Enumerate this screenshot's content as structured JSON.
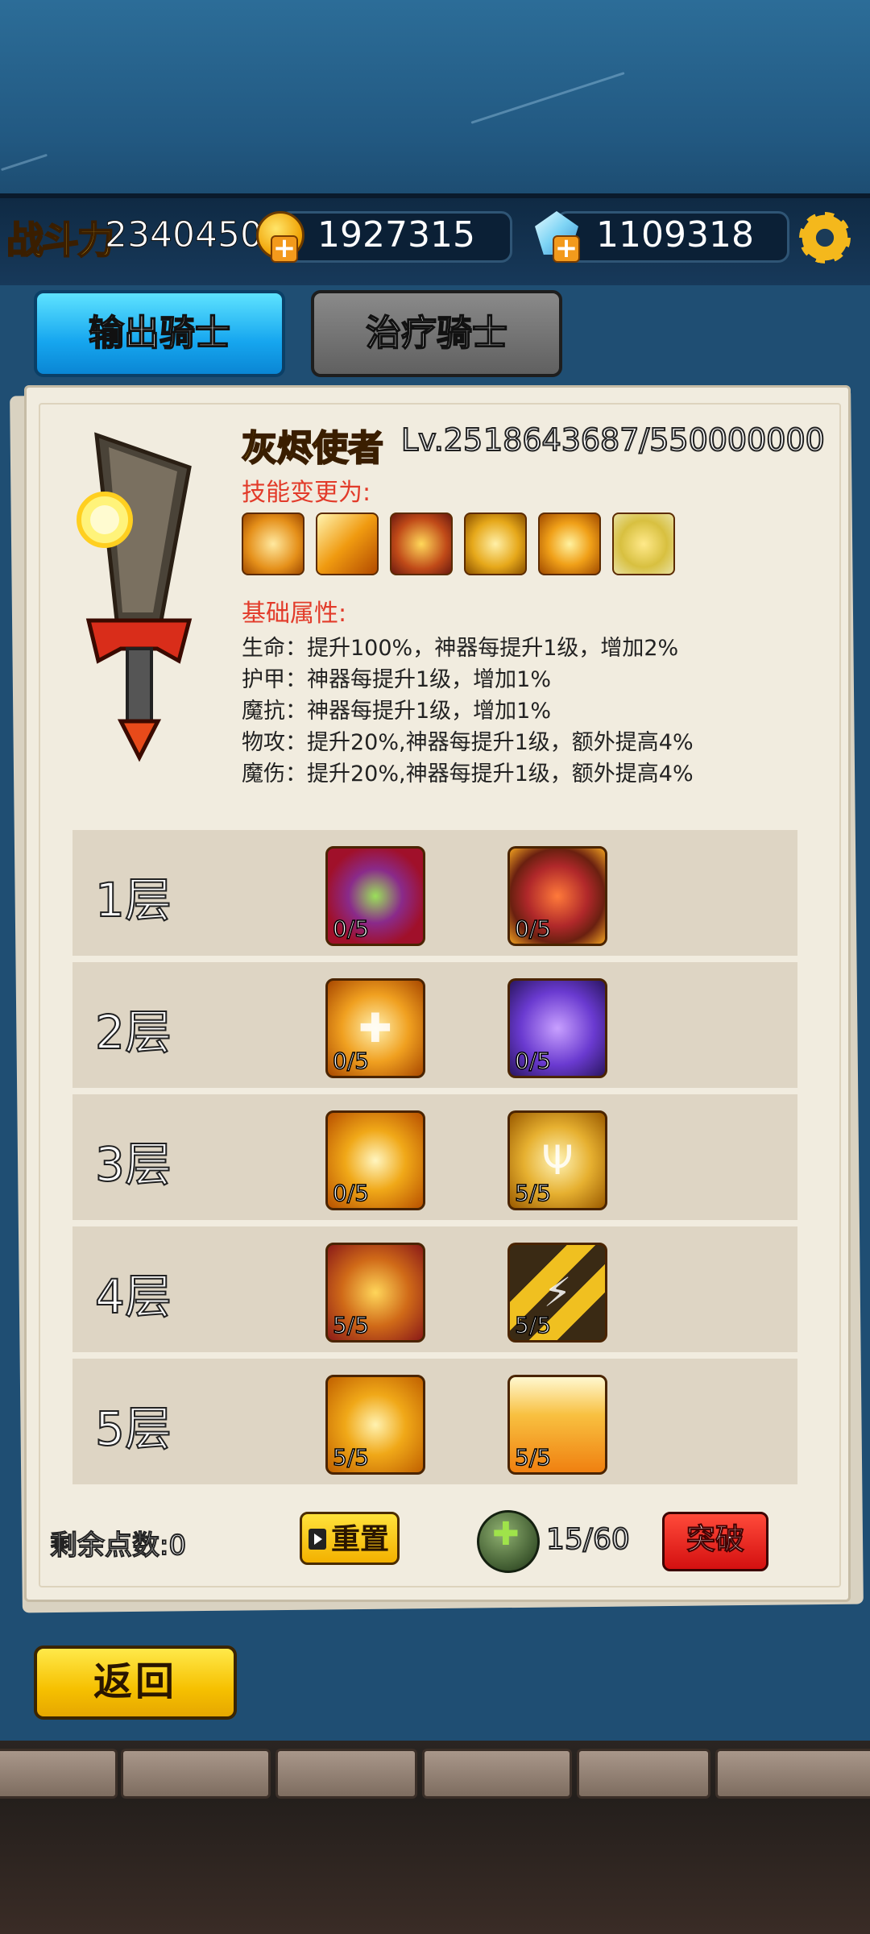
{
  "header": {
    "power_label": "战斗力",
    "power_value": "2340450",
    "gold_value": "1927315",
    "gem_value": "1109318",
    "icons": [
      "gold-coin-icon",
      "plus-icon",
      "gem-icon",
      "gear-icon"
    ]
  },
  "tabs": [
    {
      "label": "输出骑士",
      "active": true
    },
    {
      "label": "治疗骑士",
      "active": false
    }
  ],
  "artifact": {
    "name": "灰烬使者",
    "level": "Lv.25",
    "exp": "18643687/550000000",
    "skill_change_title": "技能变更为:",
    "skill_icons": [
      "chest-icon",
      "slash-icon",
      "fire-coin-icon",
      "golden-idol-icon",
      "vortex-icon",
      "shield-wings-icon"
    ],
    "base_attr_title": "基础属性:",
    "attributes": [
      "生命：提升100%，神器每提升1级，增加2%",
      "护甲：神器每提升1级，增加1%",
      "魔抗：神器每提升1级，增加1%",
      "物攻：提升20%,神器每提升1级，额外提高4%",
      "魔伤：提升20%,神器每提升1级，额外提高4%"
    ]
  },
  "tiers": [
    {
      "label": "1层",
      "skills": [
        {
          "icon": "gem-ring-icon",
          "count": "0/5"
        },
        {
          "icon": "flame-shield-icon",
          "count": "0/5"
        }
      ]
    },
    {
      "label": "2层",
      "skills": [
        {
          "icon": "holy-chest-icon",
          "count": "0/5"
        },
        {
          "icon": "spirits-icon",
          "count": "0/5"
        }
      ]
    },
    {
      "label": "3层",
      "skills": [
        {
          "icon": "vortex-icon",
          "count": "0/5"
        },
        {
          "icon": "trident-icon",
          "count": "5/5"
        }
      ]
    },
    {
      "label": "4层",
      "skills": [
        {
          "icon": "fire-coin-icon",
          "count": "5/5"
        },
        {
          "icon": "lightning-icon",
          "count": "5/5"
        }
      ]
    },
    {
      "label": "5层",
      "skills": [
        {
          "icon": "golden-vortex-icon",
          "count": "5/5"
        },
        {
          "icon": "flame-burst-icon",
          "count": "5/5"
        }
      ]
    }
  ],
  "footer": {
    "remaining_points": "剩余点数:0",
    "reset_label": "重置",
    "stone_count": "15/60",
    "breakthrough_label": "突破",
    "back_label": "返回"
  }
}
